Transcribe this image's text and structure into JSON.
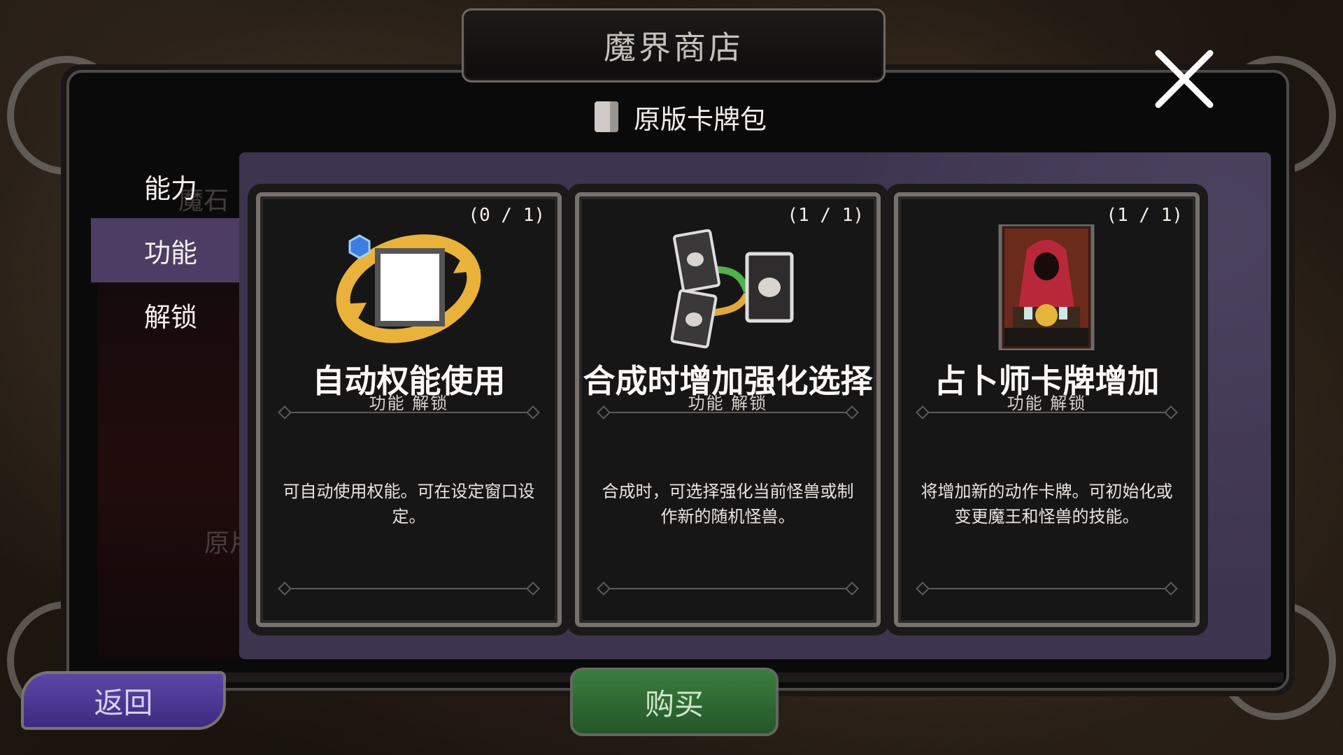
{
  "header": {
    "title": "魔界商店",
    "subtitle": "原版卡牌包"
  },
  "close": {
    "icon": "close-icon"
  },
  "sidebar": {
    "items": [
      {
        "label": "能力",
        "active": false
      },
      {
        "label": "功能",
        "active": true
      },
      {
        "label": "解锁",
        "active": false
      }
    ],
    "ghost_text_1": "魔石",
    "ghost_text_2": "原片"
  },
  "cards": [
    {
      "count": "(0 / 1)",
      "name": "自动权能使用",
      "category": "功能  解锁",
      "description": "可自动使用权能。可在设定窗口设定。",
      "icon": "auto-cycle-icon"
    },
    {
      "count": "(1 / 1)",
      "name": "合成时增加强化选择",
      "category": "功能  解锁",
      "description": "合成时，可选择强化当前怪兽或制作新的随机怪兽。",
      "icon": "card-merge-icon"
    },
    {
      "count": "(1 / 1)",
      "name": "占卜师卡牌增加",
      "category": "功能  解锁",
      "description": "将增加新的动作卡牌。可初始化或变更魔王和怪兽的技能。",
      "icon": "fortune-teller-card-icon"
    }
  ],
  "footer": {
    "back_label": "返回",
    "buy_label": "购买"
  },
  "colors": {
    "accent_purple": "#4b3d63",
    "buy_green": "#2f6b33",
    "back_purple": "#4a3794"
  }
}
